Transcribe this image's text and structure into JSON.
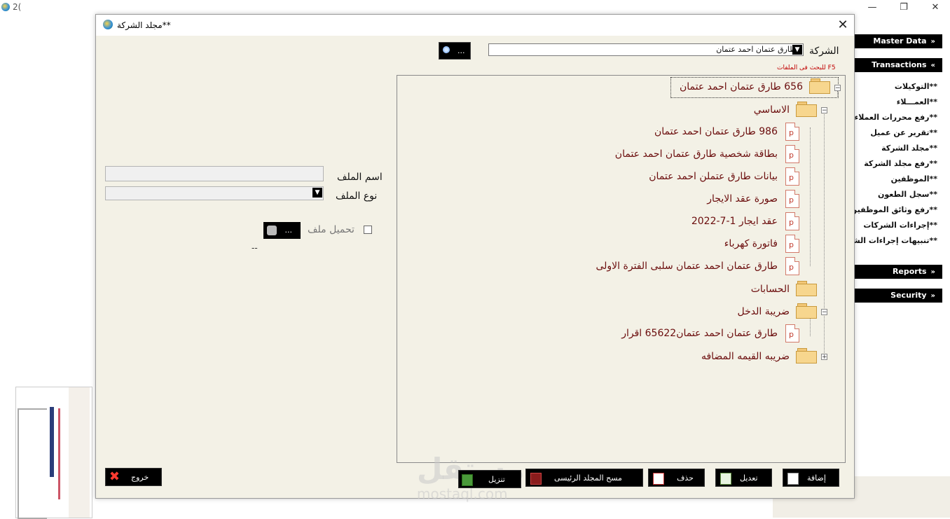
{
  "app": {
    "title": "2(",
    "window_controls": {
      "minimize": "—",
      "restore": "❐",
      "close": "✕"
    }
  },
  "side_menu": {
    "master_data": "Master Data",
    "transactions": "Transactions",
    "transaction_items": [
      "**التوكيلات",
      "**العمـــلاء",
      "**رفع محررات العملاء",
      "**تقرير عن عميل",
      "**مجلد الشركة",
      "**رفع مجلد الشركة",
      "**الموظفين",
      "**سجل الطعون",
      "**رفع وثائق الموظفين",
      "**إجراءات الشركات",
      "**تنبيهات إجراءات الشر"
    ],
    "reports": "Reports",
    "security": "Security",
    "chevron_collapsed": "»",
    "chevron_expanded": "«"
  },
  "dialog": {
    "title": "**مجلد الشركة",
    "close": "✕",
    "company_label": "الشركة",
    "company_value": "طارق عتمان احمد عتمان",
    "search_button": "...",
    "search_hint": "F5  للبحث فى الملفات",
    "tree": {
      "root": "656  طارق عتمان احمد عتمان",
      "folder_basic": "الاساسي",
      "files_basic": [
        "986 طارق عتمان احمد عتمان",
        "بطاقة شخصية طارق عتمان احمد عتمان",
        "بيانات طارق عتملن احمد عتمان",
        "صورة عقد الايجار",
        "عقد ايجار 1-7-2022",
        "فاتورة كهرباء",
        "طارق عتمان احمد عتمان سلبى الفترة الاولى"
      ],
      "folder_accounts": "الحسابات",
      "folder_income_tax": "ضريبة الدخل",
      "files_income_tax": [
        "طارق عتمان احمد عتمان65622 اقرار"
      ],
      "folder_vat": "ضريبه القيمه المضافه",
      "file_glyph": "p",
      "toggle_expanded": "−",
      "toggle_collapsed": "+"
    },
    "form": {
      "file_name_label": "اسم الملف",
      "file_name_value": "",
      "file_type_label": "نوع الملف",
      "file_type_value": "",
      "upload_label": "تحميل ملف",
      "browse_button": "...",
      "status": "--"
    },
    "buttons": {
      "add": "إضافة",
      "edit": "تعديل",
      "delete": "حذف",
      "clear_main": "مسح المجلد الرئيسى",
      "download": "تنزيل",
      "exit": "خروج"
    }
  },
  "watermark": {
    "brand": "مستقل",
    "url": "mostaql.com"
  }
}
